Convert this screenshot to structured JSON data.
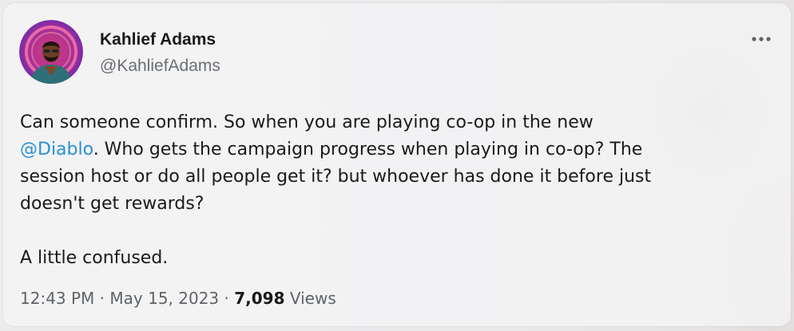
{
  "author": {
    "name": "Kahlief Adams",
    "handle": "@KahliefAdams"
  },
  "menu": {
    "icon": "more-horizontal-icon"
  },
  "tweet": {
    "line1": "Can someone confirm. So when you are playing co-op in the new",
    "mention": "@Diablo",
    "line2_rest": ". Who gets the campaign progress when playing in co-op? The",
    "line3": "session host or do all people get it? but whoever has done it before just",
    "line4": "doesn't get rewards?",
    "line5": "A little confused."
  },
  "meta": {
    "time": "12:43 PM",
    "separator": "·",
    "date": "May 15, 2023",
    "views_count": "7,098",
    "views_label": "Views"
  },
  "colors": {
    "mention": "#2a8fd6",
    "background": "#e6e6e7"
  }
}
